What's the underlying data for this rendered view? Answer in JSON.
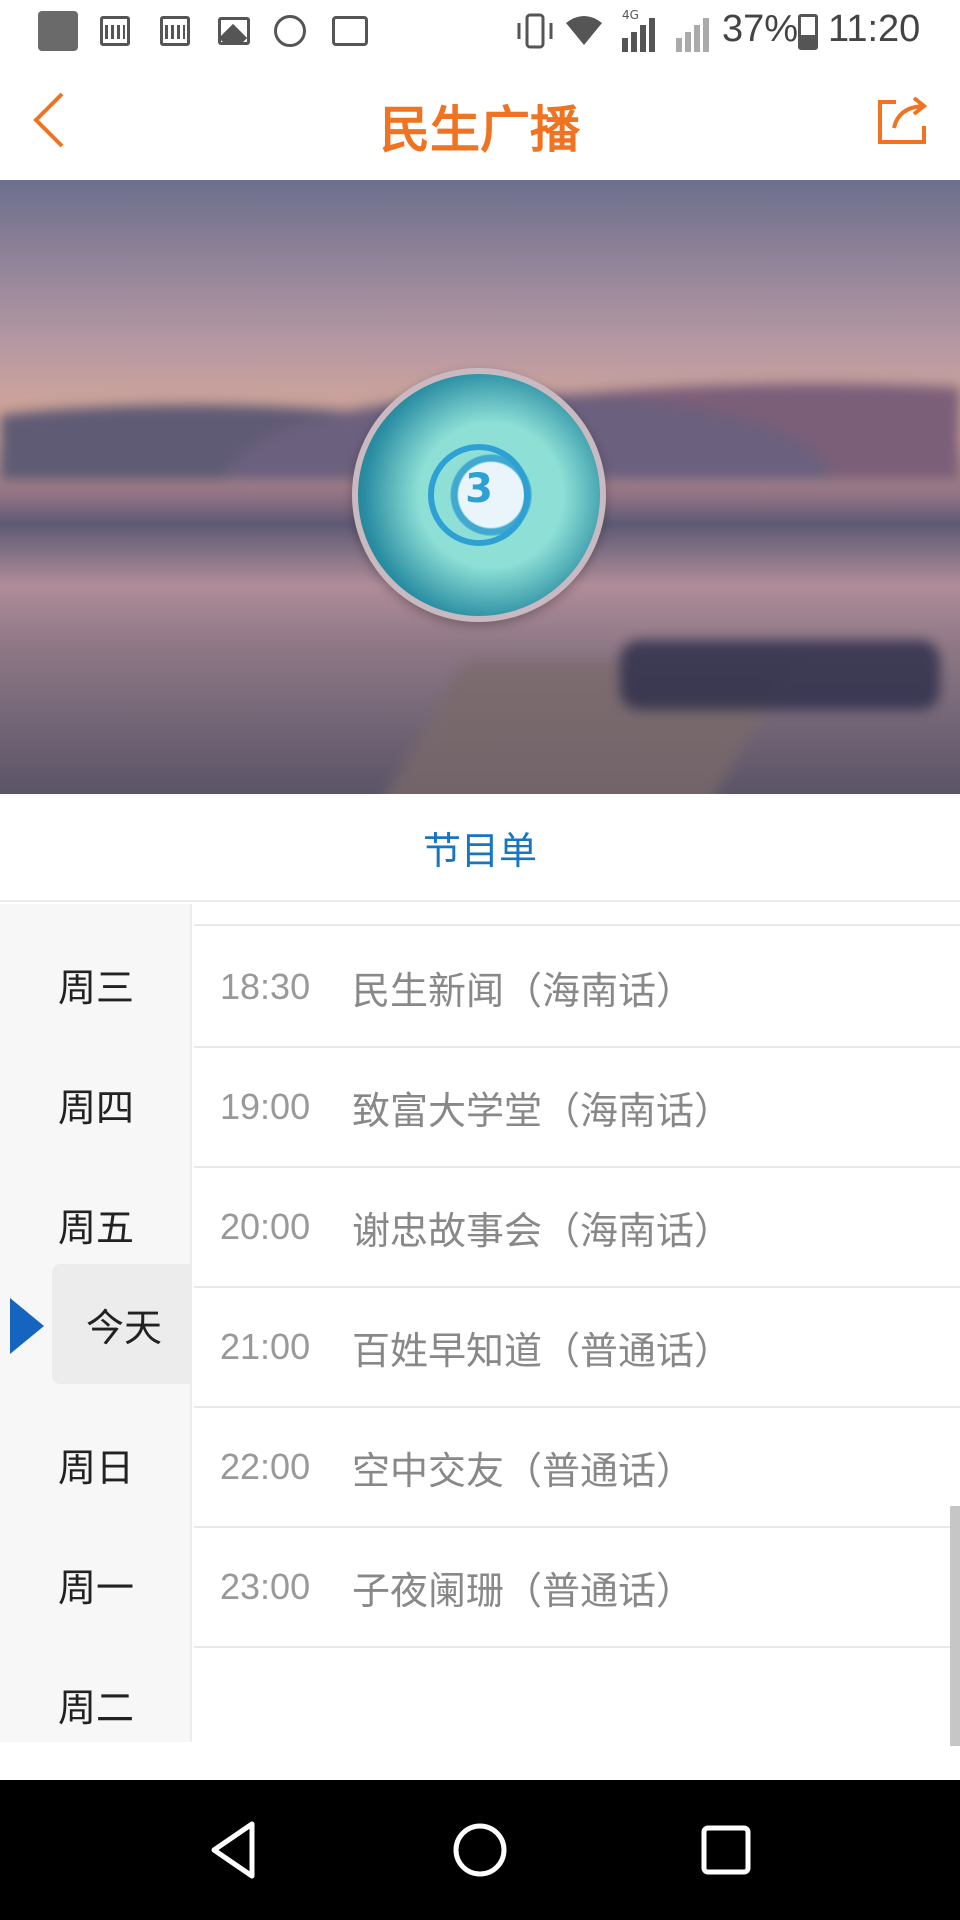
{
  "status_bar": {
    "battery_percent": "37%",
    "time": "11:20",
    "network": "4G",
    "icons": [
      "app-icon",
      "calendar-icon",
      "calendar-icon",
      "image-icon",
      "walk-icon",
      "pulse-icon",
      "vibrate-icon",
      "wifi-icon",
      "signal-icon",
      "signal-icon",
      "battery-icon"
    ]
  },
  "header": {
    "title": "民生广播",
    "back_icon": "chevron-left-icon",
    "share_icon": "share-icon"
  },
  "banner": {
    "logo_text": "3"
  },
  "program_list": {
    "title": "节目单",
    "days": [
      "周三",
      "周四",
      "周五",
      "今天",
      "周日",
      "周一",
      "周二"
    ],
    "selected_day": "今天",
    "programs": [
      {
        "time": "18:30",
        "name": "民生新闻（海南话）"
      },
      {
        "time": "19:00",
        "name": "致富大学堂（海南话）"
      },
      {
        "time": "20:00",
        "name": "谢忠故事会（海南话）"
      },
      {
        "time": "21:00",
        "name": "百姓早知道（普通话）"
      },
      {
        "time": "22:00",
        "name": "空中交友（普通话）"
      },
      {
        "time": "23:00",
        "name": "子夜阑珊（普通话）"
      }
    ]
  },
  "colors": {
    "accent": "#f07321",
    "link_blue": "#1776c0",
    "selected_arrow": "#1565c0"
  },
  "nav_bar": {
    "icons": [
      "back-triangle-icon",
      "home-circle-icon",
      "recents-square-icon"
    ]
  }
}
